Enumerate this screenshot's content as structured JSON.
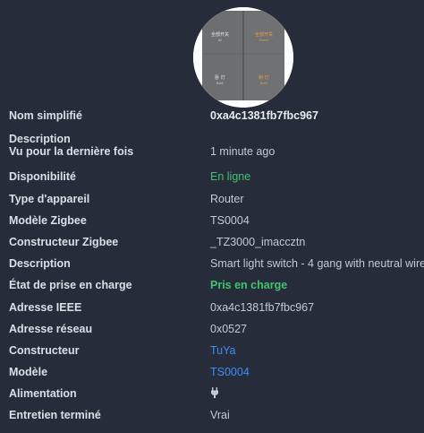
{
  "device_image": {
    "panel_labels": {
      "top_left": "全部开关",
      "top_left_sub": "All",
      "top_right": "全部开关",
      "top_right_sub": "Event",
      "bottom_left": "卧 灯",
      "bottom_left_sub": "Bath",
      "bottom_right": "射 灯",
      "bottom_right_sub": "Bath"
    }
  },
  "rows": [
    {
      "label": "Nom simplifié",
      "value": "0xa4c1381fb7fbc967"
    },
    {
      "label": "Description",
      "value": ""
    },
    {
      "label": "Vu pour la dernière fois",
      "value": "1 minute ago"
    },
    {
      "label": "Disponibilité",
      "value": "En ligne"
    },
    {
      "label": "Type d'appareil",
      "value": "Router"
    },
    {
      "label": "Modèle Zigbee",
      "value": "TS0004"
    },
    {
      "label": "Constructeur Zigbee",
      "value": "_TZ3000_imaccztn"
    },
    {
      "label": "Description",
      "value": "Smart light switch - 4 gang with neutral wire"
    },
    {
      "label": "État de prise en charge",
      "value": "Pris en charge"
    },
    {
      "label": "Adresse IEEE",
      "value": "0xa4c1381fb7fbc967"
    },
    {
      "label": "Adresse réseau",
      "value": "0x0527"
    },
    {
      "label": "Constructeur",
      "value": "TuYa"
    },
    {
      "label": "Modèle",
      "value": "TS0004"
    },
    {
      "label": "Alimentation",
      "value": "",
      "icon": "plug-icon"
    },
    {
      "label": "Entretien terminé",
      "value": "Vrai"
    }
  ],
  "colors": {
    "background": "#272c3b",
    "online_green": "#3fc46b",
    "link_blue": "#3d8ef7"
  }
}
